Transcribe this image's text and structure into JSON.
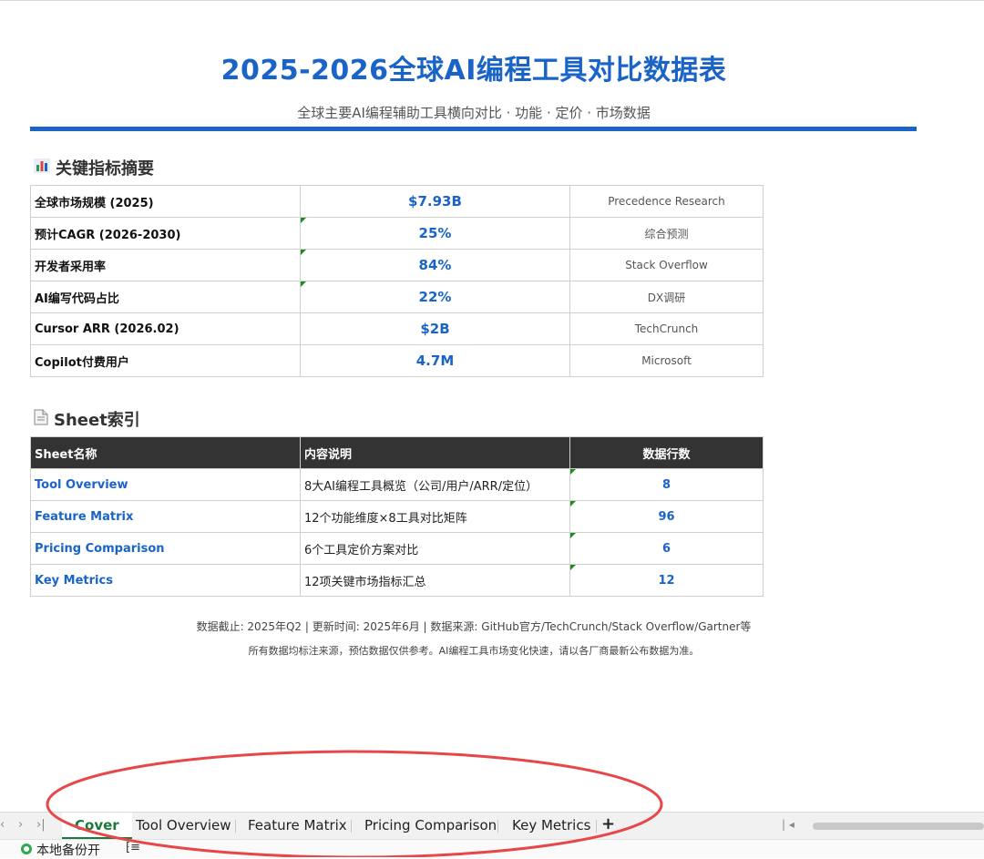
{
  "header": {
    "title": "2025-2026全球AI编程工具对比数据表",
    "subtitle": "全球主要AI编程辅助工具横向对比 · 功能 · 定价 · 市场数据"
  },
  "metrics_section": {
    "icon": "bar-chart-icon",
    "heading": "关键指标摘要",
    "rows": [
      {
        "label": "全球市场规模 (2025)",
        "value": "$7.93B",
        "source": "Precedence Research"
      },
      {
        "label": "预计CAGR (2026-2030)",
        "value": "25%",
        "source": "综合预测"
      },
      {
        "label": "开发者采用率",
        "value": "84%",
        "source": "Stack Overflow"
      },
      {
        "label": "AI编写代码占比",
        "value": "22%",
        "source": "DX调研"
      },
      {
        "label": "Cursor ARR (2026.02)",
        "value": "$2B",
        "source": "TechCrunch"
      },
      {
        "label": "Copilot付费用户",
        "value": "4.7M",
        "source": "Microsoft"
      }
    ]
  },
  "sheets_section": {
    "icon": "document-icon",
    "heading": "Sheet索引",
    "columns": [
      "Sheet名称",
      "内容说明",
      "数据行数"
    ],
    "rows": [
      {
        "name": "Tool Overview",
        "desc": "8大AI编程工具概览（公司/用户/ARR/定位）",
        "rows": "8"
      },
      {
        "name": "Feature Matrix",
        "desc": "12个功能维度×8工具对比矩阵",
        "rows": "96"
      },
      {
        "name": "Pricing Comparison",
        "desc": "6个工具定价方案对比",
        "rows": "6"
      },
      {
        "name": "Key Metrics",
        "desc": "12项关键市场指标汇总",
        "rows": "12"
      }
    ]
  },
  "footer": {
    "note1": "数据截止: 2025年Q2 | 更新时间: 2025年6月 | 数据来源: GitHub官方/TechCrunch/Stack Overflow/Gartner等",
    "note2": "所有数据均标注来源，预估数据仅供参考。AI编程工具市场变化快速，请以各厂商最新公布数据为准。"
  },
  "tabbar": {
    "tabs": [
      "Cover",
      "Tool Overview",
      "Feature Matrix",
      "Pricing Comparison",
      "Key Metrics"
    ],
    "active": "Cover",
    "add_label": "+"
  },
  "statusbar": {
    "backup_text": "本地备份开"
  },
  "colors": {
    "accent": "#1a64c8",
    "header_dark": "#333333",
    "active_tab": "#1a7a3c",
    "annotation": "#e8474a"
  }
}
